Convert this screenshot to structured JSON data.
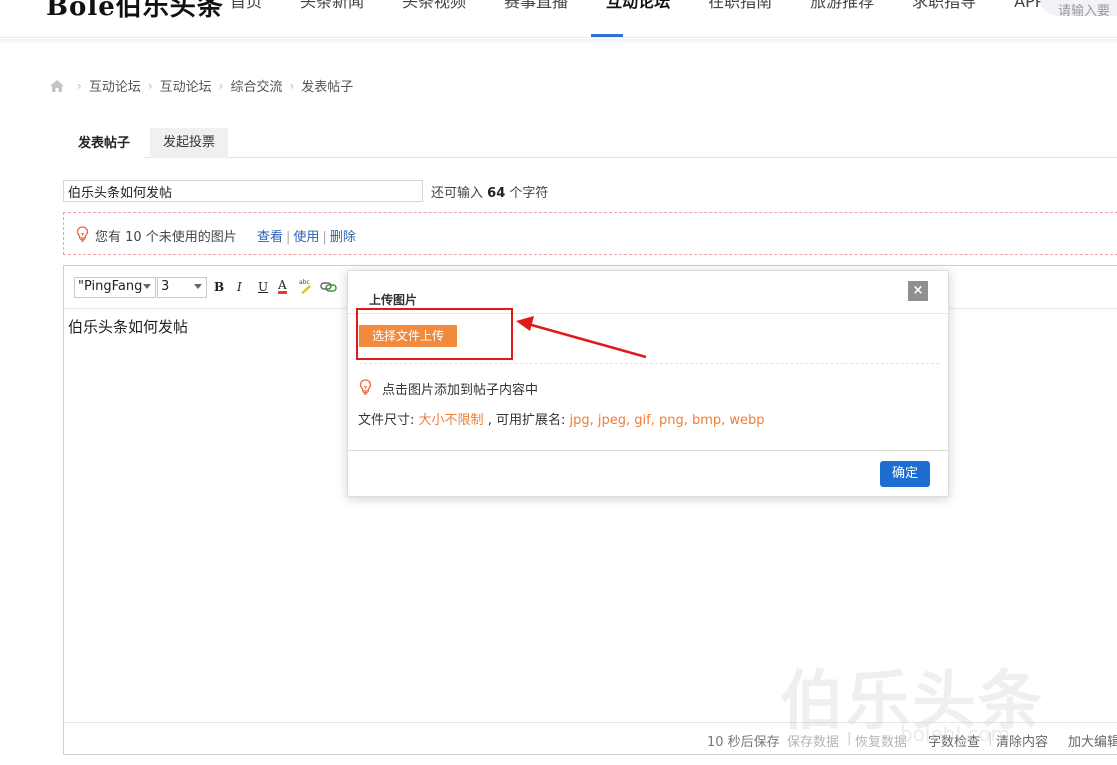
{
  "header": {
    "logo": "Bole伯乐头条",
    "nav": [
      "首页",
      "头条新闻",
      "头条视频",
      "赛事直播",
      "互动论坛",
      "在职指南",
      "旅游推荐",
      "求职指导",
      "APP下载"
    ],
    "active_nav": "互动论坛",
    "search_placeholder": "请输入要"
  },
  "breadcrumb": {
    "home_icon": "home-icon",
    "items": [
      "互动论坛",
      "互动论坛",
      "综合交流",
      "发表帖子"
    ]
  },
  "tabs": [
    "发表帖子",
    "发起投票"
  ],
  "title_field": {
    "value": "伯乐头条如何发帖",
    "remaining_prefix": "还可输入",
    "remaining_count": "64",
    "remaining_suffix": "个字符"
  },
  "notice": {
    "text": "您有 10 个未使用的图片",
    "links": [
      "查看",
      "使用",
      "删除"
    ]
  },
  "editor": {
    "font": "\"PingFang",
    "size": "3",
    "toolbar": [
      "B",
      "I",
      "U",
      "A",
      "abc",
      "link"
    ],
    "content": "伯乐头条如何发帖",
    "status": {
      "autosave": "10 秒后保存",
      "save_data": "保存数据",
      "restore_data": "恢复数据",
      "word_check": "字数检查",
      "clear_content": "清除内容",
      "enlarge": "加大编辑"
    }
  },
  "dialog": {
    "title": "上传图片",
    "close": "×",
    "upload_button": "选择文件上传",
    "tip": "点击图片添加到帖子内容中",
    "size_label": "文件尺寸:",
    "size_value": "大小不限制",
    "ext_label": ", 可用扩展名:",
    "ext_value": "jpg, jpeg, gif, png, bmp, webp",
    "confirm": "确定"
  },
  "watermark": {
    "text": "伯乐头条",
    "url": "bolehl.com"
  },
  "colors": {
    "accent_blue": "#1c6fd1",
    "orange": "#f28a3d",
    "highlight_red": "#e01919",
    "link_blue": "#2b61b6"
  }
}
